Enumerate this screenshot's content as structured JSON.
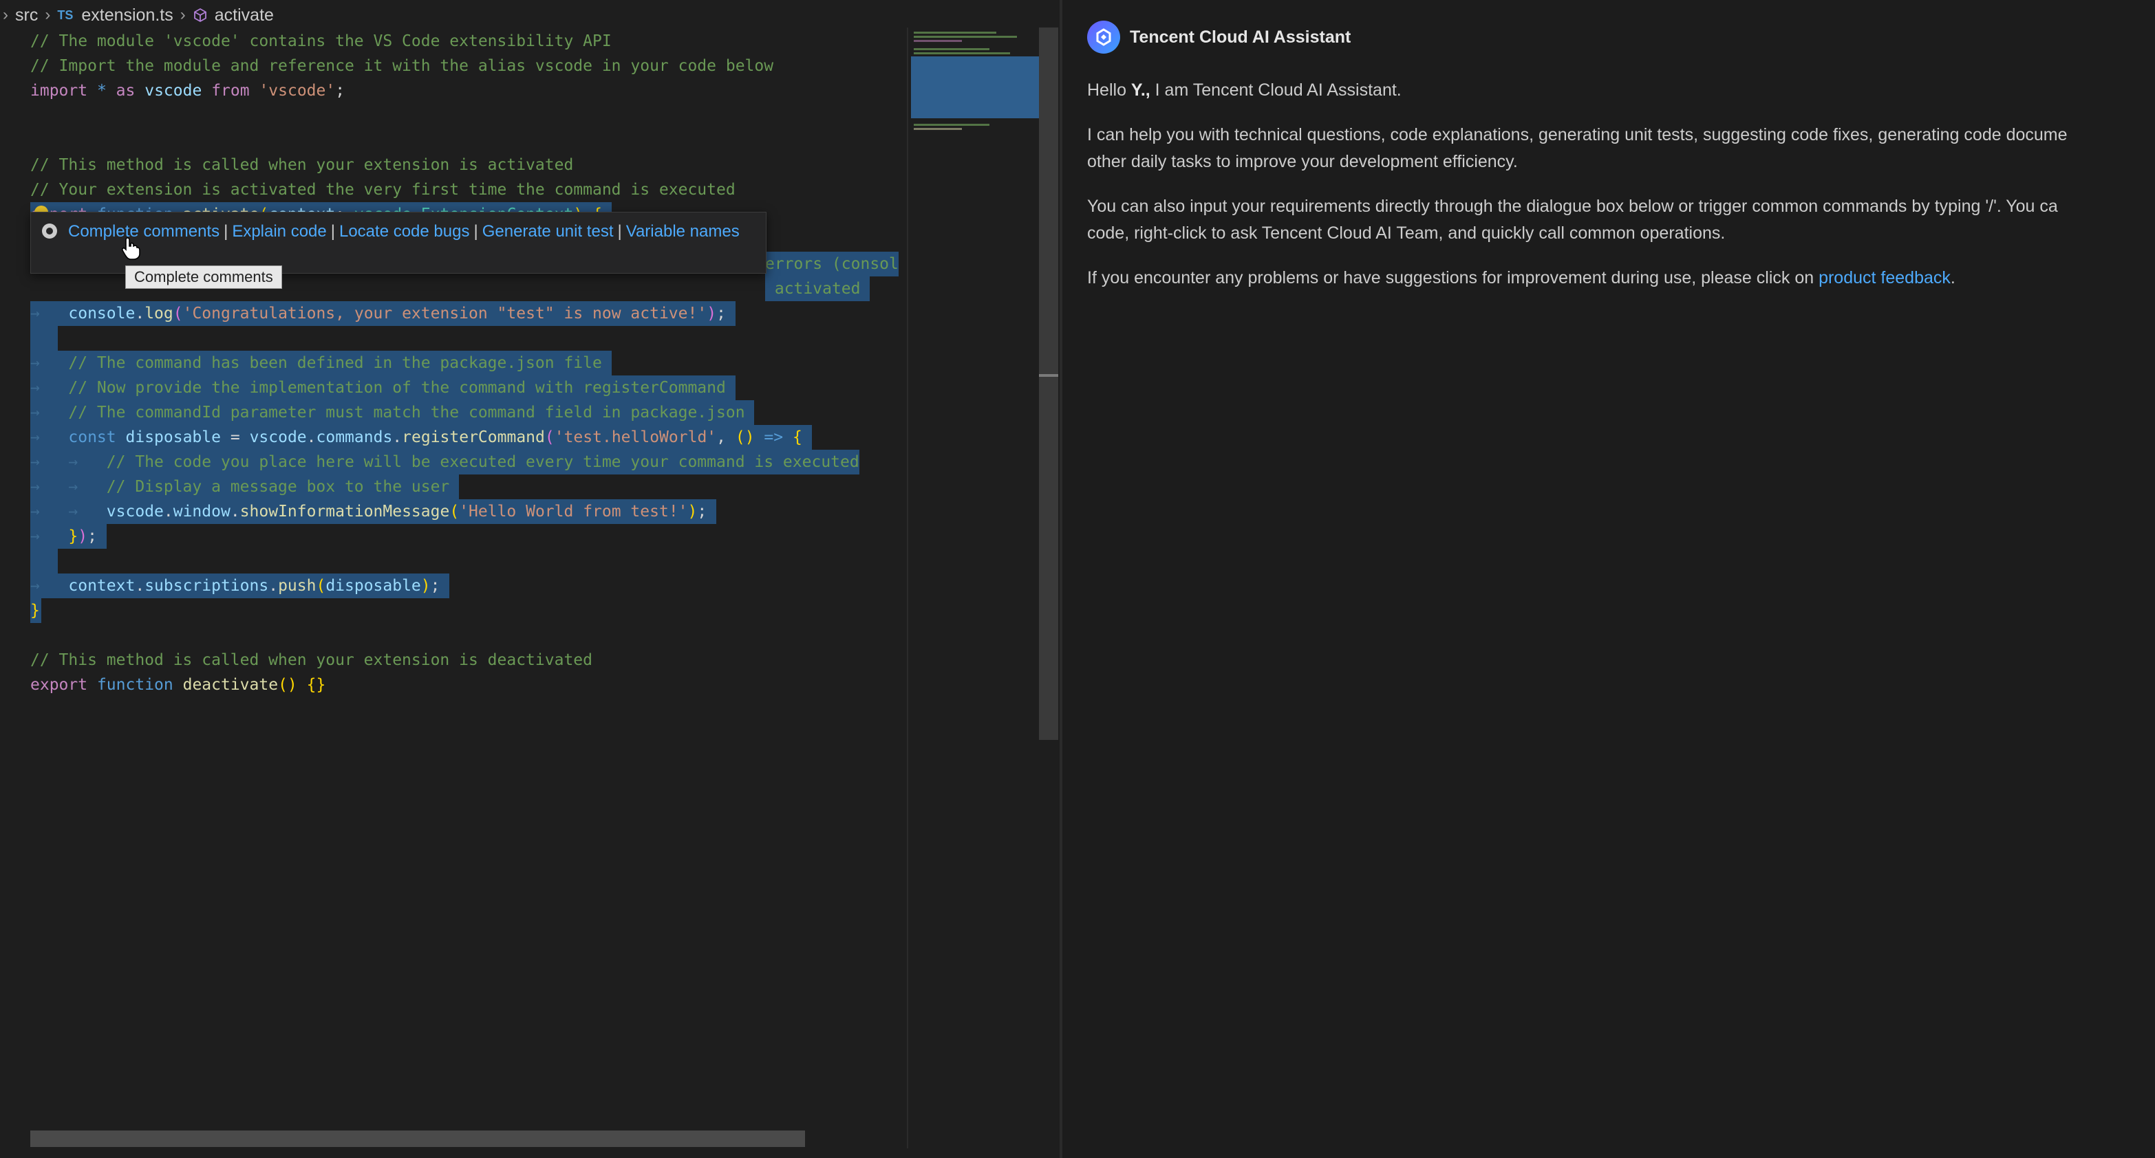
{
  "breadcrumb": {
    "folder": "src",
    "file_badge": "TS",
    "file": "extension.ts",
    "symbol": "activate"
  },
  "code_lines": [
    "// The module 'vscode' contains the VS Code extensibility API",
    "// Import the module and reference it with the alias vscode in your code below",
    "import * as vscode from 'vscode';",
    "",
    "// This method is called when your extension is activated",
    "// Your extension is activated the very first time the command is executed",
    "export function activate(context: vscode.ExtensionContext) {",
    "errors (consol",
    "activated",
    "console.log('Congratulations, your extension \"test\" is now active!');",
    "",
    "// The command has been defined in the package.json file",
    "// Now provide the implementation of the command with registerCommand",
    "// The commandId parameter must match the command field in package.json",
    "const disposable = vscode.commands.registerCommand('test.helloWorld', () => {",
    "// The code you place here will be executed every time your command is executed",
    "// Display a message box to the user",
    "vscode.window.showInformationMessage('Hello World from test!');",
    "});",
    "",
    "context.subscriptions.push(disposable);",
    "}",
    "",
    "// This method is called when your extension is deactivated",
    "export function deactivate() {}"
  ],
  "popup": {
    "actions": [
      "Complete comments",
      "Explain code",
      "Locate code bugs",
      "Generate unit test",
      "Variable names"
    ],
    "tooltip": "Complete comments"
  },
  "ai_panel": {
    "title": "Tencent Cloud AI Assistant",
    "greeting_prefix": "Hello ",
    "greeting_name": "Y.,",
    "greeting_suffix": " I am Tencent Cloud AI Assistant.",
    "para1_line1": "I can help you with technical questions, code explanations, generating unit tests, suggesting code fixes, generating code docume",
    "para1_line2": "other daily tasks to improve your development efficiency.",
    "para2_line1": "You can also input your requirements directly through the dialogue box below or trigger common commands by typing '/'. You ca",
    "para2_line2": "code, right-click to ask Tencent Cloud AI Team, and quickly call common operations.",
    "para3_prefix": "If you encounter any problems or have suggestions for improvement during use, please click on ",
    "para3_link": "product feedback",
    "para3_suffix": "."
  },
  "colors": {
    "editor_bg": "#1e1e1e",
    "selection": "#264f78",
    "comment": "#6a9955",
    "link": "#4daafc"
  },
  "icons": [
    "chevron-right-icon",
    "symbol-method-icon",
    "ai-assistant-logo-icon",
    "action-gear-icon",
    "hand-cursor-icon"
  ]
}
